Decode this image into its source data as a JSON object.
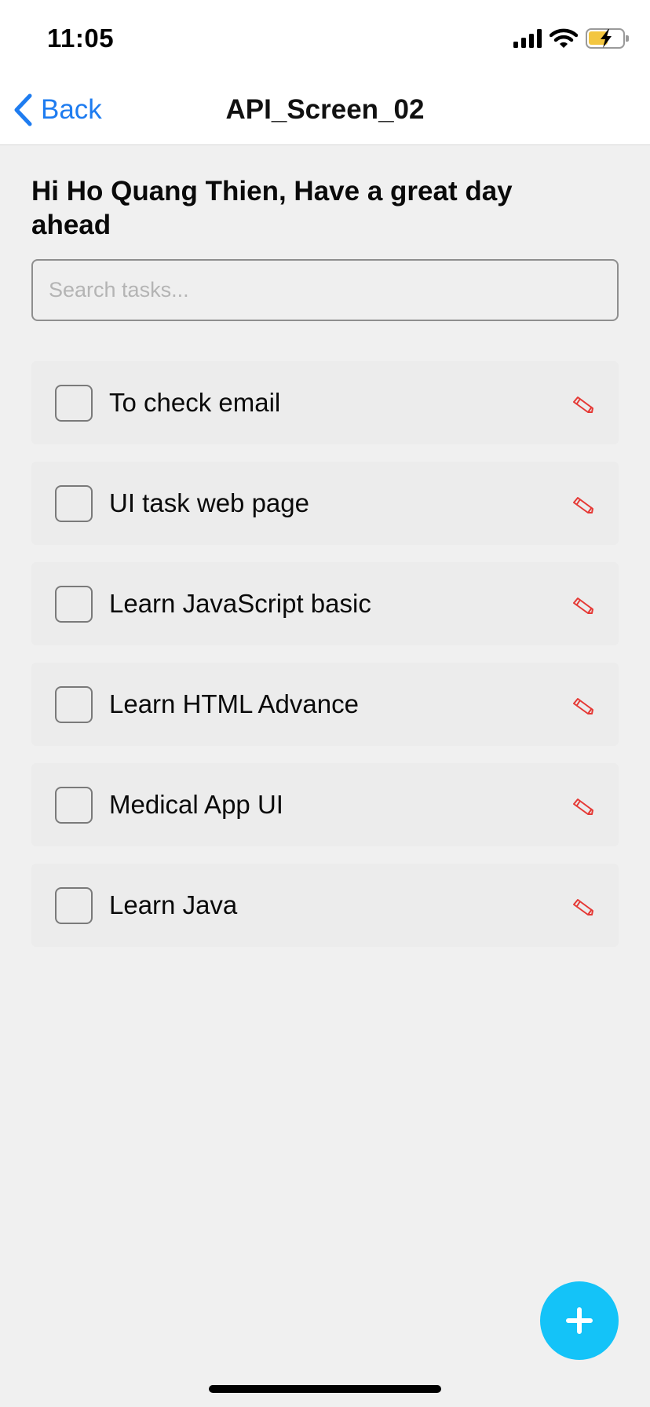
{
  "status_bar": {
    "time": "11:05",
    "icons": [
      "signal-icon",
      "wifi-icon",
      "battery-charging-icon"
    ],
    "battery_color": "#f3c640"
  },
  "nav": {
    "back_label": "Back",
    "title": "API_Screen_02",
    "accent_color": "#1e7cf0"
  },
  "greeting": "Hi Ho Quang Thien, Have a great day ahead",
  "search": {
    "placeholder": "Search tasks...",
    "value": ""
  },
  "tasks": [
    {
      "title": "To check email",
      "checked": false
    },
    {
      "title": "UI task web page",
      "checked": false
    },
    {
      "title": "Learn JavaScript basic",
      "checked": false
    },
    {
      "title": "Learn HTML Advance",
      "checked": false
    },
    {
      "title": "Medical App UI",
      "checked": false
    },
    {
      "title": "Learn Java",
      "checked": false
    }
  ],
  "task_edit_icon": "pencil-icon",
  "task_edit_color": "#e53935",
  "fab": {
    "icon": "plus-icon",
    "color": "#14c3f8"
  }
}
